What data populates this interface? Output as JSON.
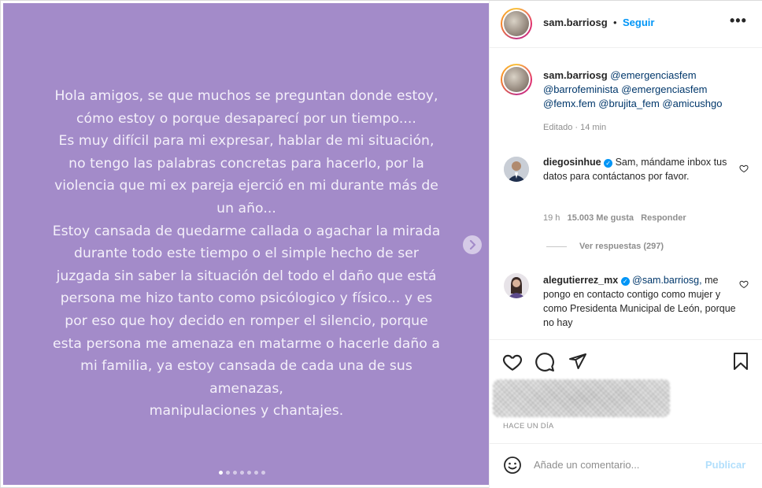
{
  "post": {
    "lines": [
      "Hola amigos, se que muchos se preguntan donde estoy,",
      "cómo estoy o porque desaparecí por un tiempo....",
      "Es muy difícil para mi expresar, hablar de mi situación,",
      "no tengo las palabras concretas para hacerlo, por la",
      "violencia que mi ex pareja ejerció en mi durante más de",
      "un año...",
      "Estoy cansada de quedarme callada o agachar la mirada",
      "durante todo este tiempo o el simple hecho de ser",
      "juzgada sin saber la situación del todo el daño que está",
      "persona me hizo tanto como psicólogico y físico... y es",
      "por eso que hoy decido en romper el silencio, porque",
      "esta persona me amenaza en matarme o hacerle daño a",
      "mi familia, ya estoy cansada de cada una de sus",
      "amenazas,",
      "manipulaciones y chantajes."
    ],
    "background_color": "#a38bc9",
    "carousel_dots": 7,
    "carousel_active": 0
  },
  "header": {
    "username": "sam.barriosg",
    "separator": "•",
    "follow_label": "Seguir",
    "more_icon": "more-horizontal-icon",
    "more_label": "•••"
  },
  "caption": {
    "username": "sam.barriosg",
    "m1": "@emergenciasfem",
    "m2": "@barrofeminista",
    "m3": "@emergenciasfem",
    "m4": "@femx.fem",
    "m5": "@brujita_fem",
    "m6": "@amicushgo",
    "meta": "Editado · 14 min"
  },
  "comments": [
    {
      "username": "diegosinhue",
      "text": "Sam, mándame inbox tus datos para contáctanos por favor.",
      "time": "19 h",
      "likes": "15.003 Me gusta",
      "reply_label": "Responder",
      "view_replies": "Ver respuestas (297)"
    },
    {
      "username": "alegutierrez_mx",
      "mention": "@sam.barriosg,",
      "text": "me pongo en contacto contigo como mujer y como Presidenta Municipal de León, porque no hay"
    }
  ],
  "footer": {
    "time_ago": "HACE UN DÍA",
    "comment_placeholder": "Añade un comentario...",
    "publish_label": "Publicar"
  },
  "colors": {
    "accent": "#0095f6",
    "publish_disabled": "#b2dffc",
    "image_bg": "#a38bc9"
  }
}
